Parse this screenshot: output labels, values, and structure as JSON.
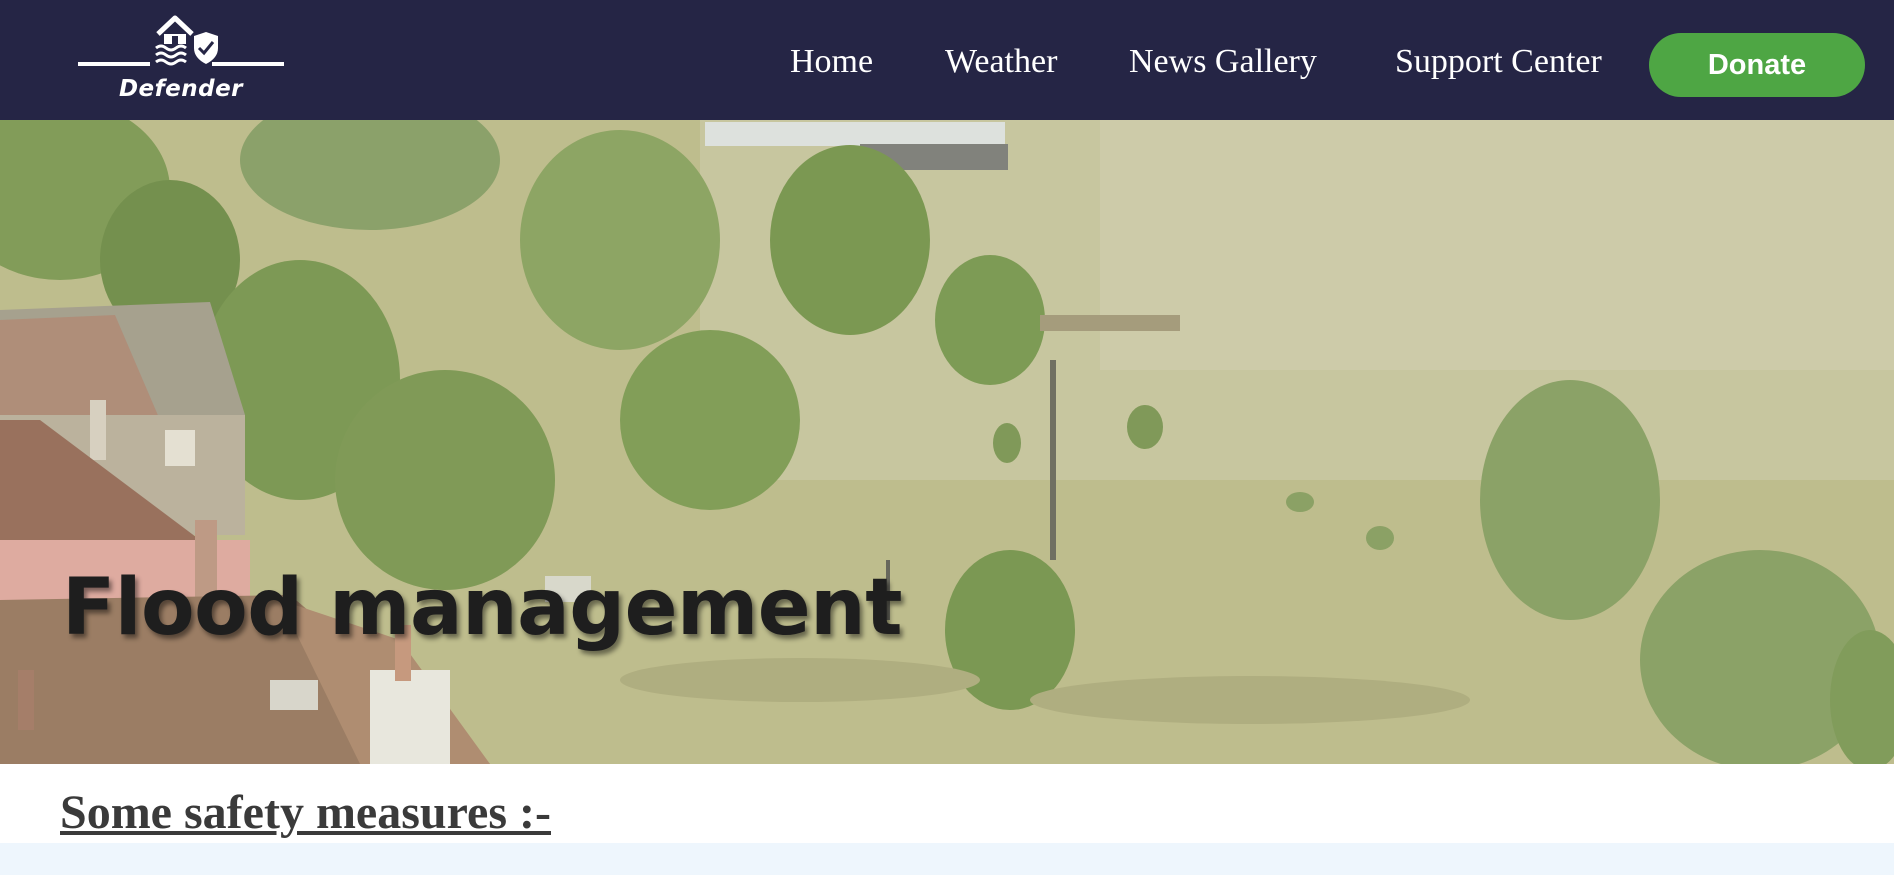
{
  "brand": {
    "name": "Defender",
    "icon": "house-shield-water-icon"
  },
  "nav": {
    "links": [
      "Home",
      "Weather",
      "News Gallery",
      "Support Center"
    ],
    "donate_label": "Donate"
  },
  "hero": {
    "title": "Flood management",
    "image": "flooded-town-aerial-photo"
  },
  "section": {
    "heading": "Some safety measures :-"
  },
  "colors": {
    "navbar": "#252545",
    "donate": "#4ea644",
    "hero_overlay": "#c8c890",
    "bottom_strip": "#eef6fd"
  }
}
